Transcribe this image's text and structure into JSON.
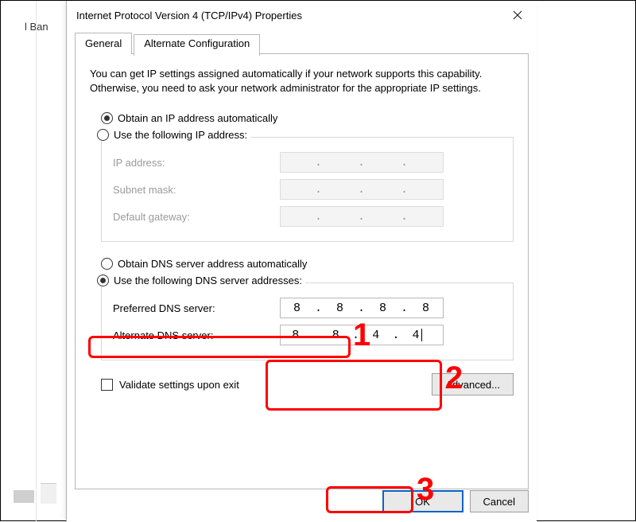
{
  "background": {
    "truncated_label": "l Ban"
  },
  "dialog": {
    "title": "Internet Protocol Version 4 (TCP/IPv4) Properties",
    "tabs": {
      "general": "General",
      "alternate": "Alternate Configuration"
    },
    "intro": "You can get IP settings assigned automatically if your network supports this capability. Otherwise, you need to ask your network administrator for the appropriate IP settings.",
    "ip_section": {
      "obtain_auto": "Obtain an IP address automatically",
      "use_following": "Use the following IP address:",
      "ip_address_label": "IP address:",
      "subnet_label": "Subnet mask:",
      "gateway_label": "Default gateway:"
    },
    "dns_section": {
      "obtain_auto": "Obtain DNS server address automatically",
      "use_following": "Use the following DNS server addresses:",
      "preferred_label": "Preferred DNS server:",
      "alternate_label": "Alternate DNS server:",
      "preferred_value": [
        "8",
        "8",
        "8",
        "8"
      ],
      "alternate_value": [
        "8",
        "8",
        "4",
        "4"
      ]
    },
    "validate_label": "Validate settings upon exit",
    "advanced_label": "Advanced...",
    "ok_label": "OK",
    "cancel_label": "Cancel"
  },
  "annotations": {
    "n1": "1",
    "n2": "2",
    "n3": "3"
  }
}
